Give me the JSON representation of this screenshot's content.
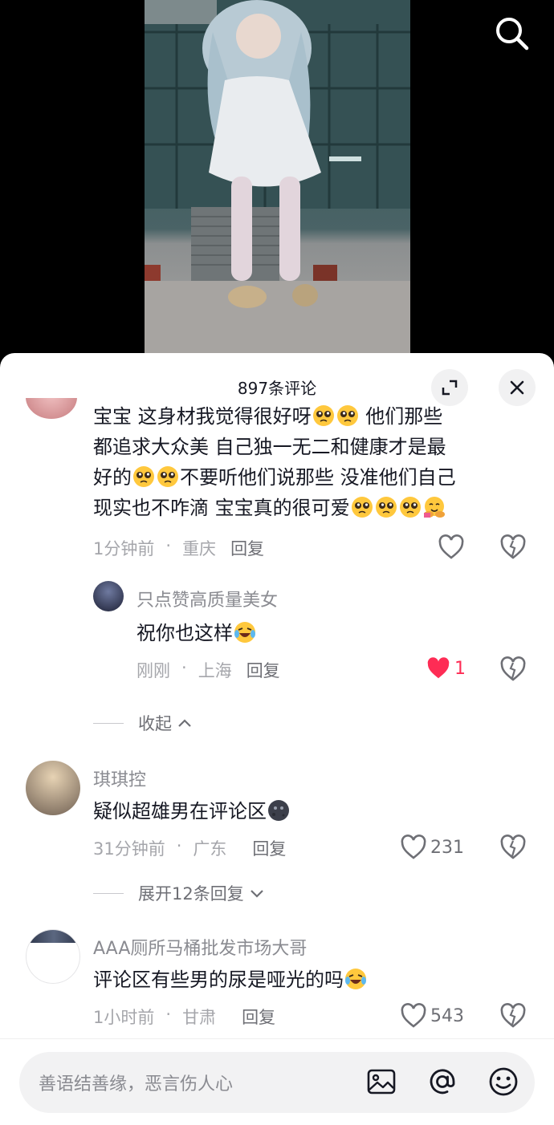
{
  "sheet": {
    "title": "897条评论",
    "expand_icon": "expand-icon",
    "close_icon": "close-icon"
  },
  "comments": [
    {
      "text_line1": "宝宝 这身材我觉得很好呀",
      "text_line1_tail": " 他们那些",
      "text_line2": "都追求大众美 自己独一无二和健康才是最",
      "text_line3a": "好的",
      "text_line3b": "不要听他们说那些 没准他们自己",
      "text_line4": "现实也不咋滴  宝宝真的很可爱",
      "time": "1分钟前",
      "location": "重庆",
      "reply": "回复"
    },
    {
      "name": "只点赞高质量美女",
      "text": "祝你也这样",
      "time": "刚刚",
      "location": "上海",
      "reply": "回复",
      "likes": "1"
    },
    {
      "fold_label": "收起"
    },
    {
      "name": "琪琪控",
      "text": "疑似超雄男在评论区",
      "time": "31分钟前",
      "location": "广东",
      "reply": "回复",
      "likes": "231",
      "expand_label": "展开12条回复"
    },
    {
      "name": "AAA厕所马桶批发市场大哥",
      "text": "评论区有些男的尿是哑光的吗",
      "time": "1小时前",
      "location": "甘肃",
      "reply": "回复",
      "likes": "543"
    }
  ],
  "input": {
    "placeholder": "善语结善缘，恶言伤人心"
  },
  "colors": {
    "accent": "#fe2c55",
    "text": "#161823",
    "muted": "#a5a6ab"
  }
}
